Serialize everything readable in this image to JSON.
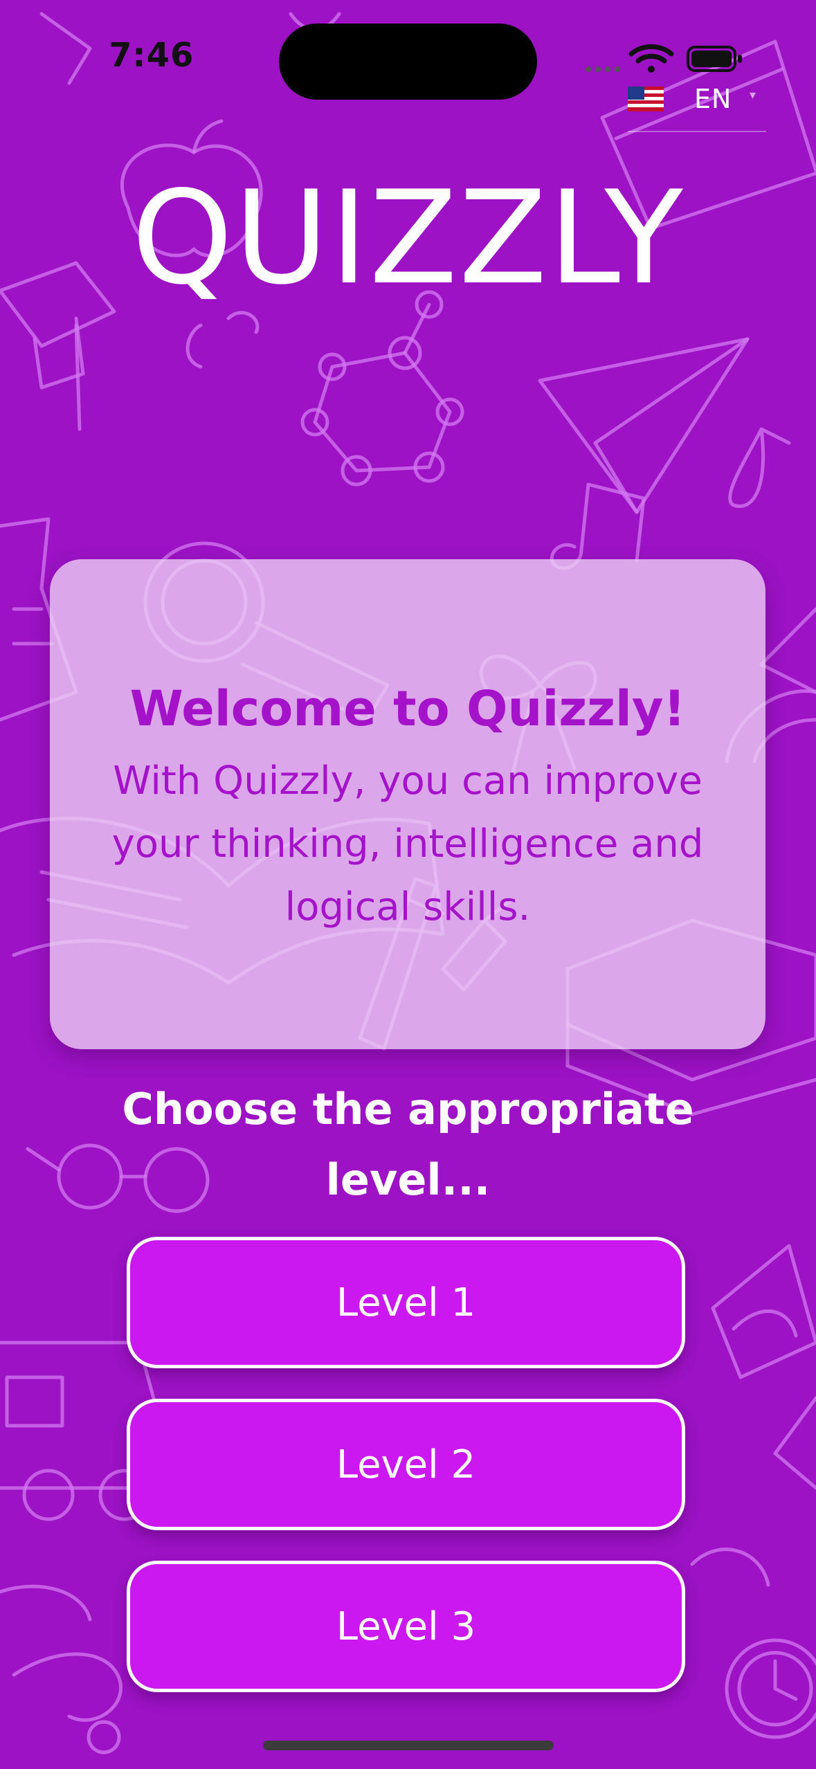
{
  "status_bar": {
    "time": "7:46"
  },
  "language_selector": {
    "flag_icon": "us-flag-icon",
    "code": "EN",
    "caret": "▾"
  },
  "header": {
    "title": "QUIZZLY"
  },
  "welcome_card": {
    "title": "Welcome to Quizzly!",
    "body": "With Quizzly, you can improve your thinking, intelligence and logical skills."
  },
  "level_prompt": "Choose the appropriate level...",
  "levels": [
    {
      "label": "Level 1"
    },
    {
      "label": "Level 2"
    },
    {
      "label": "Level 3"
    }
  ],
  "colors": {
    "background": "#9c12c4",
    "accent_text": "#a413c9",
    "button_fill": "#cc18f0",
    "doodle_stroke": "#d37af0"
  }
}
